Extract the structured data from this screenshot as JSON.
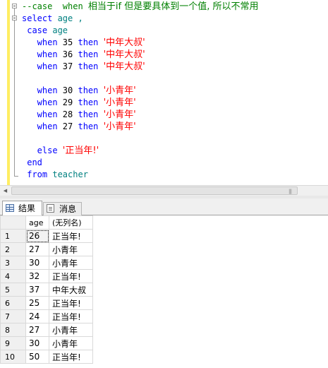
{
  "editor": {
    "lines": [
      [
        {
          "t": "--case  when ",
          "c": "cm"
        },
        {
          "t": "相当于if 但是要具体到一个值, 所以不常用",
          "c": "cm cjk"
        }
      ],
      [
        {
          "t": "select ",
          "c": "kw"
        },
        {
          "t": "age ,",
          "c": "id"
        }
      ],
      [
        {
          "t": " case ",
          "c": "kw"
        },
        {
          "t": "age",
          "c": "id"
        }
      ],
      [
        {
          "t": "   when ",
          "c": "kw"
        },
        {
          "t": "35 ",
          "c": "tx"
        },
        {
          "t": "then ",
          "c": "kw"
        },
        {
          "t": "'中年大叔'",
          "c": "str cjk"
        }
      ],
      [
        {
          "t": "   when ",
          "c": "kw"
        },
        {
          "t": "36 ",
          "c": "tx"
        },
        {
          "t": "then ",
          "c": "kw"
        },
        {
          "t": "'中年大叔'",
          "c": "str cjk"
        }
      ],
      [
        {
          "t": "   when ",
          "c": "kw"
        },
        {
          "t": "37 ",
          "c": "tx"
        },
        {
          "t": "then ",
          "c": "kw"
        },
        {
          "t": "'中年大叔'",
          "c": "str cjk"
        }
      ],
      [],
      [
        {
          "t": "   when ",
          "c": "kw"
        },
        {
          "t": "30 ",
          "c": "tx"
        },
        {
          "t": "then ",
          "c": "kw"
        },
        {
          "t": "'小青年'",
          "c": "str cjk"
        }
      ],
      [
        {
          "t": "   when ",
          "c": "kw"
        },
        {
          "t": "29 ",
          "c": "tx"
        },
        {
          "t": "then ",
          "c": "kw"
        },
        {
          "t": "'小青年'",
          "c": "str cjk"
        }
      ],
      [
        {
          "t": "   when ",
          "c": "kw"
        },
        {
          "t": "28 ",
          "c": "tx"
        },
        {
          "t": "then ",
          "c": "kw"
        },
        {
          "t": "'小青年'",
          "c": "str cjk"
        }
      ],
      [
        {
          "t": "   when ",
          "c": "kw"
        },
        {
          "t": "27 ",
          "c": "tx"
        },
        {
          "t": "then ",
          "c": "kw"
        },
        {
          "t": "'小青年'",
          "c": "str cjk"
        }
      ],
      [],
      [
        {
          "t": "   else ",
          "c": "kw"
        },
        {
          "t": "'正当年!'",
          "c": "str cjk"
        }
      ],
      [
        {
          "t": " end",
          "c": "kw"
        }
      ],
      [
        {
          "t": " from ",
          "c": "kw"
        },
        {
          "t": "teacher",
          "c": "id"
        }
      ]
    ]
  },
  "tabs": {
    "results_label": "结果",
    "messages_label": "消息"
  },
  "results": {
    "columns": [
      "age",
      "(无列名)"
    ],
    "rows": [
      {
        "n": "1",
        "age": "26",
        "label": "正当年!"
      },
      {
        "n": "2",
        "age": "27",
        "label": "小青年"
      },
      {
        "n": "3",
        "age": "30",
        "label": "小青年"
      },
      {
        "n": "4",
        "age": "32",
        "label": "正当年!"
      },
      {
        "n": "5",
        "age": "37",
        "label": "中年大叔"
      },
      {
        "n": "6",
        "age": "25",
        "label": "正当年!"
      },
      {
        "n": "7",
        "age": "24",
        "label": "正当年!"
      },
      {
        "n": "8",
        "age": "27",
        "label": "小青年"
      },
      {
        "n": "9",
        "age": "30",
        "label": "小青年"
      },
      {
        "n": "10",
        "age": "50",
        "label": "正当年!"
      }
    ]
  },
  "icons": {
    "results_tab": "grid-icon",
    "messages_tab": "message-icon",
    "collapse": "collapse-icon",
    "scroll_left": "arrow-left-icon",
    "grip": "scroll-grip-icon"
  }
}
